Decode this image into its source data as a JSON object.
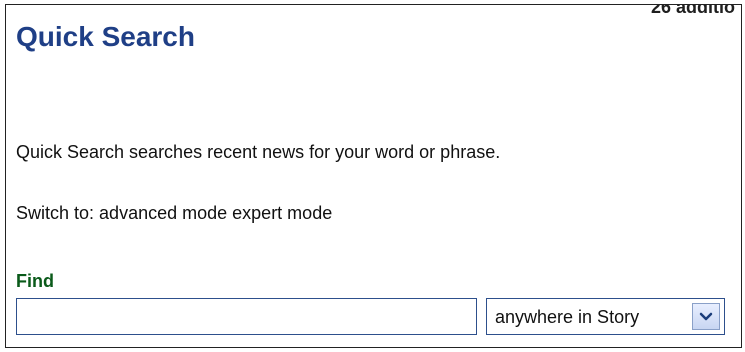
{
  "header": {
    "partial_text": "26 additio"
  },
  "page": {
    "title": "Quick Search",
    "description": "Quick Search searches recent news for your word or phrase."
  },
  "switch": {
    "prefix": "Switch to:",
    "advanced_mode": "advanced mode",
    "expert_mode": "expert mode"
  },
  "search": {
    "find_label": "Find",
    "input_value": "",
    "input_placeholder": ""
  },
  "scope": {
    "selected": "anywhere in Story",
    "icon": "chevron-down-icon"
  },
  "colors": {
    "title": "#1f3f86",
    "find_label": "#0a5a1a",
    "input_border": "#2d4f8c"
  }
}
